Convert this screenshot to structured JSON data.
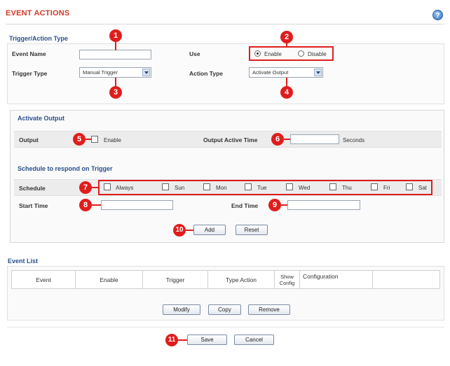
{
  "header": {
    "title": "EVENT ACTIONS",
    "help_icon": "?"
  },
  "trigger_section": {
    "title": "Trigger/Action Type",
    "event_name_label": "Event Name",
    "event_name_value": "",
    "use_label": "Use",
    "use_options": [
      "Enable",
      "Disable"
    ],
    "use_selected": "Enable",
    "trigger_type_label": "Trigger Type",
    "trigger_type_value": "Manual Trigger",
    "action_type_label": "Action Type",
    "action_type_value": "Activate Output"
  },
  "activate_output": {
    "title": "Activate Output",
    "output_label": "Output",
    "output_enable_label": "Enable",
    "active_time_label": "Output Active Time",
    "active_time_value": "",
    "seconds_label": "Seconds"
  },
  "schedule_section": {
    "title": "Schedule to respond on Trigger",
    "schedule_label": "Schedule",
    "days": [
      "Always",
      "Sun",
      "Mon",
      "Tue",
      "Wed",
      "Thu",
      "Fri",
      "Sat"
    ],
    "start_time_label": "Start Time",
    "start_time_value": "",
    "end_time_label": "End Time",
    "end_time_value": "",
    "add_button": "Add",
    "reset_button": "Reset"
  },
  "event_list": {
    "title": "Event List",
    "columns": [
      "Event",
      "Enable",
      "Trigger",
      "Type Action",
      "Show Config",
      "Configuration",
      ""
    ],
    "modify_button": "Modify",
    "copy_button": "Copy",
    "remove_button": "Remove"
  },
  "footer": {
    "save_button": "Save",
    "cancel_button": "Cancel"
  },
  "markers": [
    "1",
    "2",
    "3",
    "4",
    "5",
    "6",
    "7",
    "8",
    "9",
    "10",
    "11"
  ],
  "colors": {
    "marker_red": "#e01d1d",
    "title_red": "#d23a2a",
    "section_blue": "#2a4f8a"
  }
}
